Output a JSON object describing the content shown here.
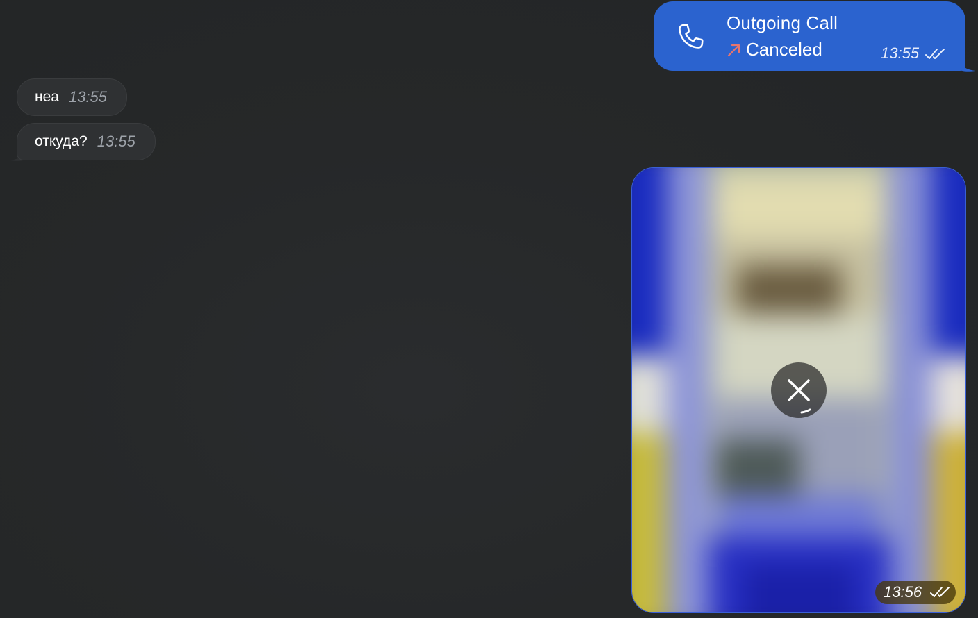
{
  "call": {
    "title": "Outgoing Call",
    "status": "Canceled",
    "time": "13:55",
    "icon": "phone-icon",
    "status_icon": "outgoing-arrow-icon",
    "read_icon": "double-check-icon",
    "bubble_color": "#2b63cf",
    "arrow_color": "#e8756e"
  },
  "messages": [
    {
      "text": "неа",
      "time": "13:55"
    },
    {
      "text": "откуда?",
      "time": "13:55"
    }
  ],
  "media": {
    "time": "13:56",
    "cancel_icon": "close-icon",
    "read_icon": "double-check-icon"
  }
}
